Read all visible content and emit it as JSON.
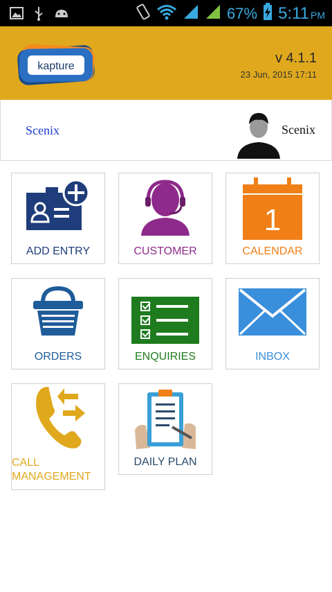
{
  "status_bar": {
    "battery_percent": "67%",
    "time": "5:11",
    "ampm": "PM",
    "icons": [
      "image-icon",
      "usb-icon",
      "android-icon",
      "vibrate-icon",
      "wifi-icon",
      "signal-icon",
      "signal-icon",
      "battery-charging-icon"
    ]
  },
  "header": {
    "logo_text": "kapture",
    "version": "v 4.1.1",
    "datetime": "23 Jun, 2015 17:11",
    "background_color": "#e0a81c"
  },
  "user": {
    "company": "Scenix",
    "name": "Scenix"
  },
  "tiles": [
    {
      "label": "ADD ENTRY",
      "color": "#1f3d7a"
    },
    {
      "label": "CUSTOMER",
      "color": "#8e2a8b"
    },
    {
      "label": "CALENDAR",
      "color": "#f07f17"
    },
    {
      "label": "ORDERS",
      "color": "#1f5c9a"
    },
    {
      "label": "ENQUIRIES",
      "color": "#1e7b1e"
    },
    {
      "label": "INBOX",
      "color": "#3a8fdc"
    },
    {
      "label_line1": "CALL",
      "label_line2": "MANAGEMENT",
      "color": "#e0a81c"
    },
    {
      "label": "DAILY PLAN",
      "color": "#2a4a6a"
    }
  ],
  "calendar_day": "1"
}
